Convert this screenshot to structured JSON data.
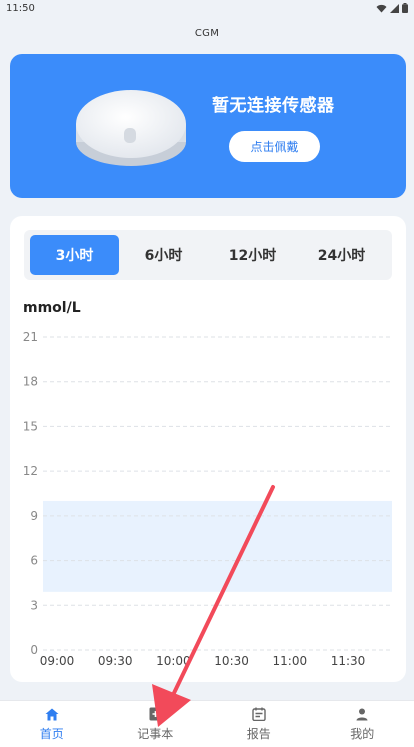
{
  "status_bar": {
    "time": "11:50"
  },
  "app": {
    "title": "CGM"
  },
  "sensor": {
    "status_text": "暂无连接传感器",
    "wear_button_label": "点击佩戴"
  },
  "range_tabs": [
    {
      "label": "3小时",
      "active": true
    },
    {
      "label": "6小时",
      "active": false
    },
    {
      "label": "12小时",
      "active": false
    },
    {
      "label": "24小时",
      "active": false
    }
  ],
  "chart_data": {
    "type": "line",
    "ylabel": "mmol/L",
    "xlabel": "",
    "y_ticks": [
      "21",
      "18",
      "15",
      "12",
      "9",
      "6",
      "3",
      "0"
    ],
    "x_ticks": [
      "09:00",
      "09:30",
      "10:00",
      "10:30",
      "11:00",
      "11:30"
    ],
    "ylim": [
      0,
      21
    ],
    "target_range": [
      3.9,
      10
    ],
    "series": [],
    "grid": true
  },
  "bottom_nav": [
    {
      "label": "首页",
      "icon": "home-icon",
      "active": true
    },
    {
      "label": "记事本",
      "icon": "notebook-icon",
      "active": false
    },
    {
      "label": "报告",
      "icon": "report-icon",
      "active": false
    },
    {
      "label": "我的",
      "icon": "profile-icon",
      "active": false
    }
  ],
  "colors": {
    "accent": "#3b8cfa",
    "target_band": "#e8f2fe",
    "annotation_arrow": "#f24a5a"
  }
}
